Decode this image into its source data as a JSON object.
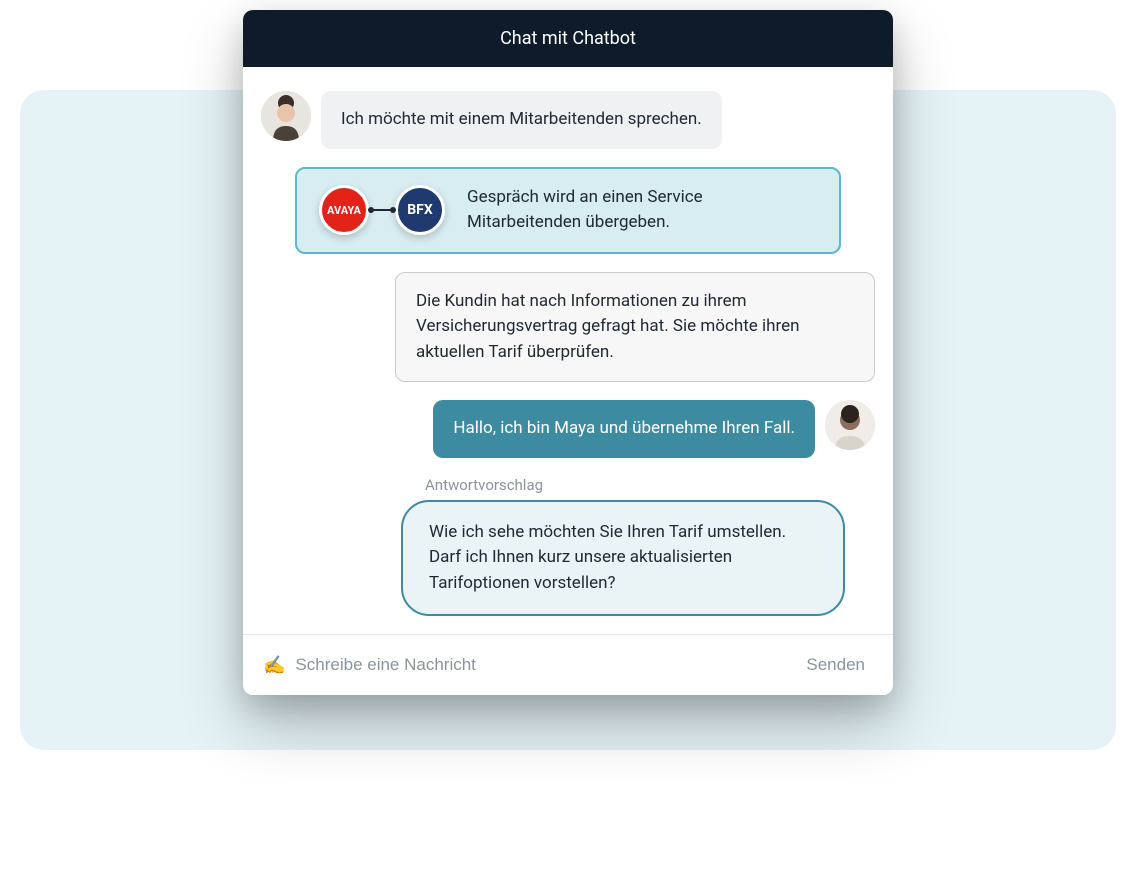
{
  "header": {
    "title": "Chat mit Chatbot"
  },
  "messages": {
    "user_msg": "Ich möchte mit einem Mitarbeitenden sprechen.",
    "handoff": {
      "logo_a": "AVAYA",
      "logo_b": "BFX",
      "text": "Gespräch wird an einen Service Mitarbeitenden übergeben."
    },
    "context": "Die Kundin hat nach Informationen zu ihrem Versicherungsvertrag gefragt hat. Sie möchte ihren aktuellen Tarif überprüfen.",
    "agent_msg": "Hallo, ich bin Maya und übernehme Ihren Fall.",
    "suggestion_label": "Antwortvorschlag",
    "suggestion": "Wie ich sehe möchten Sie Ihren Tarif umstellen. Darf ich Ihnen kurz unsere aktualisierten Tarifoptionen vorstellen?"
  },
  "input": {
    "icon": "✍️",
    "placeholder": "Schreibe eine Nachricht",
    "send_label": "Senden"
  }
}
